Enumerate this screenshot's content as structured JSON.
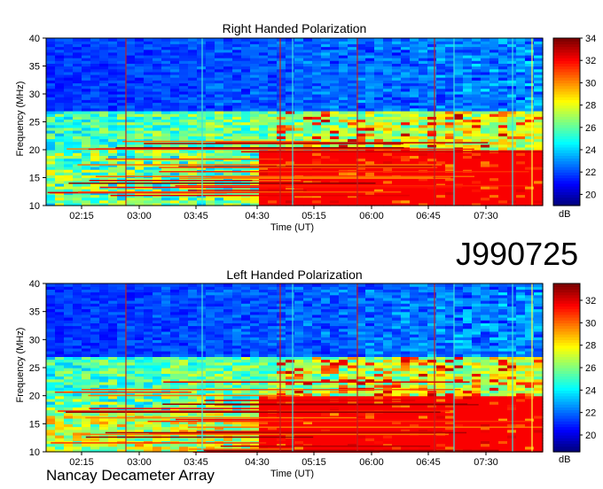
{
  "observation_id": "J990725",
  "footer": "Nancay Decameter Array",
  "chart_data": [
    {
      "type": "heatmap",
      "title": "Right Handed Polarization",
      "xlabel": "Time (UT)",
      "ylabel": "Frequency (MHz)",
      "x_ticks": [
        "02:15",
        "03:00",
        "03:45",
        "04:30",
        "05:15",
        "06:00",
        "06:45",
        "07:30"
      ],
      "y_ticks": [
        10,
        15,
        20,
        25,
        30,
        35,
        40
      ],
      "ylim": [
        10,
        40
      ],
      "colorbar": {
        "label": "dB",
        "ticks": [
          20,
          22,
          24,
          26,
          28,
          30,
          32,
          34
        ],
        "range": [
          19,
          34
        ]
      },
      "vertical_lines_colors": [
        "#c02020",
        "#40e0e0",
        "#ffff40"
      ]
    },
    {
      "type": "heatmap",
      "title": "Left Handed Polarization",
      "xlabel": "Time (UT)",
      "ylabel": "Frequency (MHz)",
      "x_ticks": [
        "02:15",
        "03:00",
        "03:45",
        "04:30",
        "05:15",
        "06:00",
        "06:45",
        "07:30"
      ],
      "y_ticks": [
        10,
        15,
        20,
        25,
        30,
        35,
        40
      ],
      "ylim": [
        10,
        40
      ],
      "colorbar": {
        "label": "dB",
        "ticks": [
          20,
          22,
          24,
          26,
          28,
          30,
          32
        ],
        "range": [
          18.5,
          33.5
        ]
      },
      "vertical_lines_colors": [
        "#c02020",
        "#40e0e0",
        "#ffff40"
      ]
    }
  ]
}
